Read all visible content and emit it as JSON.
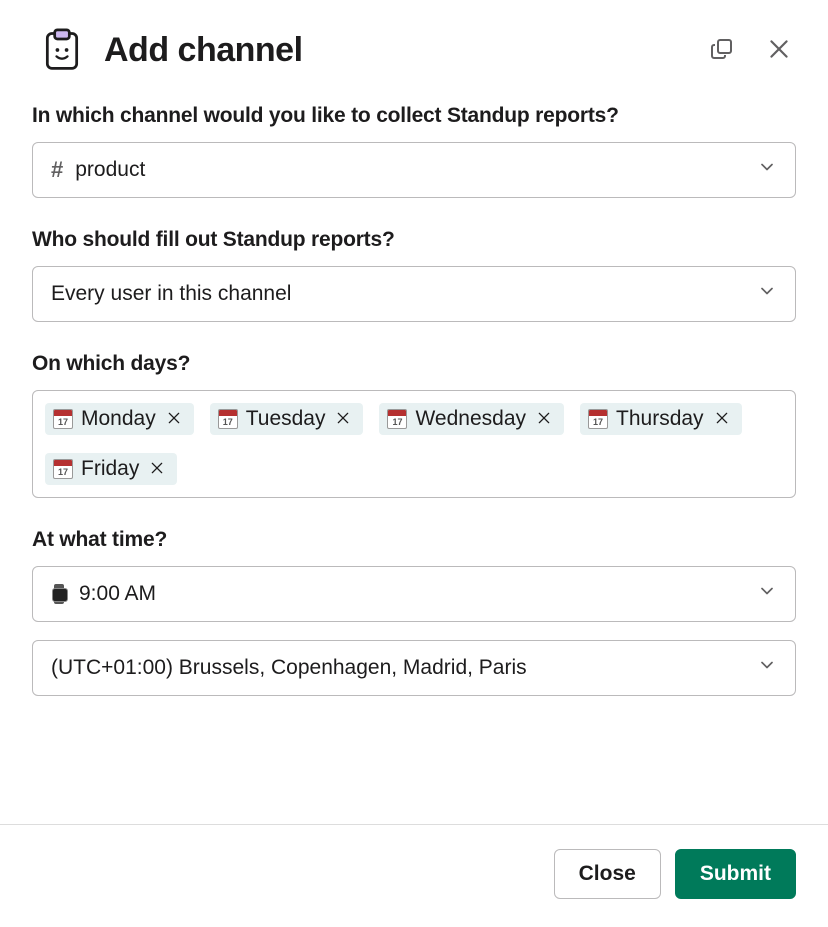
{
  "header": {
    "title": "Add channel"
  },
  "fields": {
    "channel": {
      "label": "In which channel would you like to collect Standup reports?",
      "value": "product"
    },
    "who": {
      "label": "Who should fill out Standup reports?",
      "value": "Every user in this channel"
    },
    "days": {
      "label": "On which days?",
      "selected": [
        {
          "label": "Monday"
        },
        {
          "label": "Tuesday"
        },
        {
          "label": "Wednesday"
        },
        {
          "label": "Thursday"
        },
        {
          "label": "Friday"
        }
      ]
    },
    "time": {
      "label": "At what time?",
      "value": "9:00 AM"
    },
    "timezone": {
      "value": "(UTC+01:00) Brussels, Copenhagen, Madrid, Paris"
    }
  },
  "footer": {
    "close_label": "Close",
    "submit_label": "Submit"
  },
  "icons": {
    "calendar_day": "17"
  }
}
